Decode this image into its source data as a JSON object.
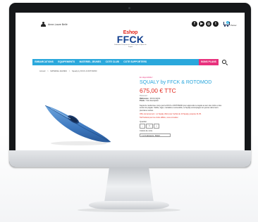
{
  "header": {
    "account_label": "Anne-Laure Bellé",
    "social_icons": [
      "facebook-icon",
      "youtube-icon",
      "instagram-icon",
      "twitter-icon"
    ],
    "social_glyphs": [
      "f",
      "▶",
      "◎",
      "t"
    ],
    "cart_label": "Panier",
    "cart_count": "0"
  },
  "logo": {
    "eshop": "Eshop",
    "ffck": "FFCK",
    "tagline": "Fédération Française de Canoë Kayak et Sports de Pagaie"
  },
  "nav": {
    "items": [
      "EMBARCATIONS",
      "EQUIPEMENTS",
      "MATERIEL JEUNES",
      "COTE CLUB",
      "COTE SUPPORTERS",
      "BONS PLANS"
    ]
  },
  "breadcrumb": [
    "Accueil",
    ">",
    "MATERIEL JEUNES",
    ">",
    "Squaly by FFCK & ROTOMOD"
  ],
  "product": {
    "availability": "En disponibilité !",
    "title": "SQUALY by FFCK & ROTOMOD",
    "price": "675,00 € TTC",
    "brand": "Rotomod",
    "reference_label": "Référence :",
    "reference_value": "FFCK-SQ01",
    "weight_label": "Poids :",
    "weight_value": "Voir description",
    "description": "Kayak de randonnée conçu par la FFCK et ROTOMOD pour apprendre le kayak au sein des clubs et des écoles de pagaie. Stable, léger, maniable et accessible, le Squaly accompagne les jeunes dans leurs premières sorties.",
    "promo_line1": "Offre de lancement : un Squaly offert pour l'achat de 10 Squaly, jusqu'au 31.05.",
    "promo_line2": "Tarif fédéral pour les clubs affiliés, nous consulter.",
    "quantity_label": "Quantité",
    "quantity_value": "1",
    "size_label": "Coloris de votre",
    "size_value": "1 à 5 éléments : BLEU"
  },
  "colors": {
    "nav_bg": "#2aa8dc",
    "hot_bg": "#e8317d",
    "title": "#29a6dc",
    "price": "#e2261c",
    "logo_blue": "#123f8f"
  }
}
